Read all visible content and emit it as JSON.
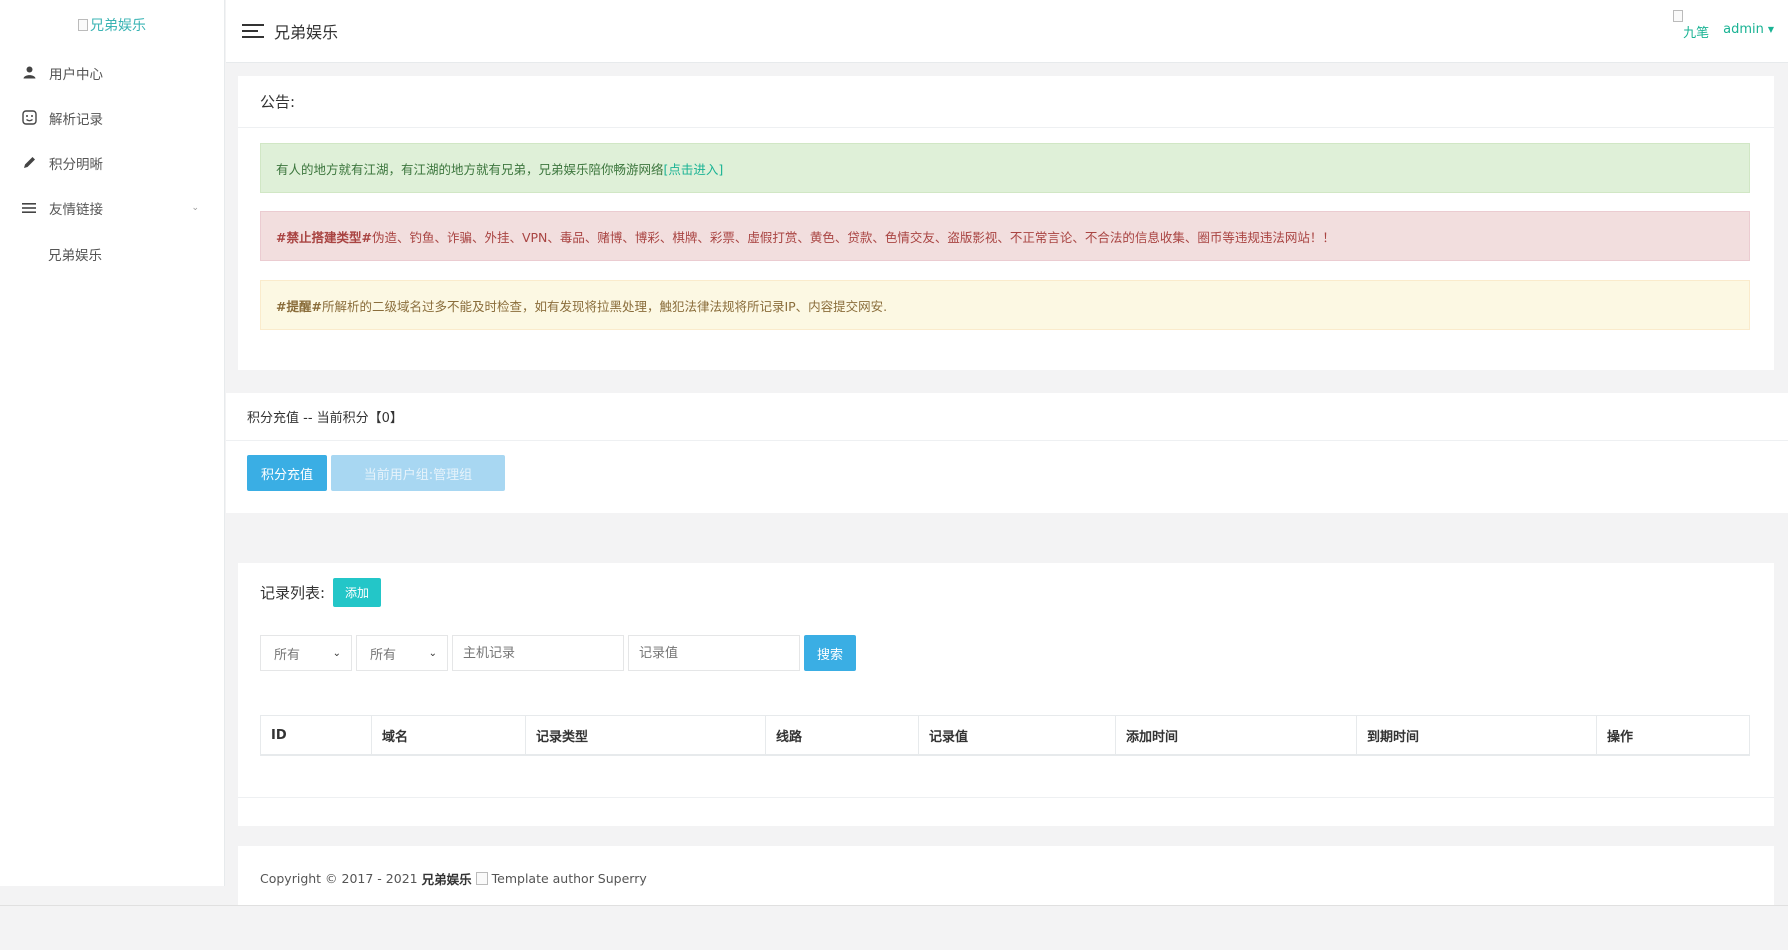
{
  "sidebar": {
    "logo_alt": "兄弟娱乐",
    "items": [
      {
        "label": "用户中心",
        "icon": "user-icon"
      },
      {
        "label": "解析记录",
        "icon": "record-icon"
      },
      {
        "label": "积分明晰",
        "icon": "pencil-icon"
      },
      {
        "label": "友情链接",
        "icon": "list-icon"
      }
    ],
    "sub_item": "兄弟娱乐"
  },
  "topbar": {
    "title": "兄弟娱乐",
    "avatar_alt": "九笔",
    "user": "admin"
  },
  "notice": {
    "title": "公告:",
    "success_text": "有人的地方就有江湖，有江湖的地方就有兄弟，兄弟娱乐陪你畅游网络",
    "success_link": "[点击进入]",
    "danger_bold": "#禁止搭建类型#",
    "danger_text": " 伪造、钓鱼、诈骗、外挂、VPN、毒品、赌博、博彩、棋牌、彩票、虚假打赏、黄色、贷款、色情交友、盗版影视、不正常言论、不合法的信息收集、圈币等违规违法网站！！",
    "warning_bold": "#提醒#",
    "warning_text": " 所解析的二级域名过多不能及时检查，如有发现将拉黑处理，触犯法律法规将所记录IP、内容提交网安."
  },
  "score": {
    "title": "积分充值 -- 当前积分【0】",
    "recharge_button": "积分充值",
    "group_button": "当前用户组:管理组"
  },
  "records": {
    "title": "记录列表:",
    "add_button": "添加",
    "select1": "所有",
    "select2": "所有",
    "host_placeholder": "主机记录",
    "value_placeholder": "记录值",
    "search_button": "搜索",
    "columns": [
      "ID",
      "域名",
      "记录类型",
      "线路",
      "记录值",
      "添加时间",
      "到期时间",
      "操作"
    ]
  },
  "footer": {
    "prefix": "Copyright © 2017 - 2021",
    "site": "兄弟娱乐",
    "suffix": "Template author Superry"
  },
  "colors": {
    "accent": "#1ab394",
    "primary_button": "#3aaee4",
    "add_button": "#23c6c8"
  }
}
